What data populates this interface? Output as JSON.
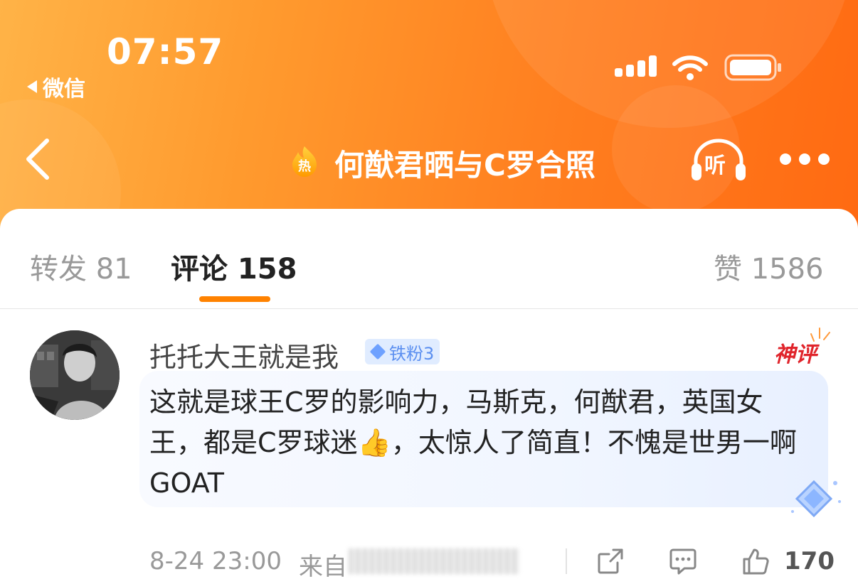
{
  "status_bar": {
    "time": "07:57",
    "back_app": "微信",
    "icons": [
      "signal-icon",
      "wifi-icon",
      "battery-icon"
    ]
  },
  "nav": {
    "title": "何猷君晒与C罗合照",
    "hot_badge": "热",
    "listen_label": "听",
    "icons": [
      "back-chevron-icon",
      "hot-badge-icon",
      "headphones-icon",
      "more-icon"
    ]
  },
  "tabs": {
    "repost": "转发 81",
    "comment": "评论 158",
    "likes": "赞 1586",
    "active": "comment"
  },
  "comment": {
    "username": "托托大王就是我",
    "fan_badge": "铁粉3",
    "god_label": "神评",
    "text": "这就是球王C罗的影响力，马斯克，何猷君，英国女王，都是C罗球迷👍，太惊人了简直！不愧是世男一啊GOAT",
    "time": "8-24 23:00",
    "source_prefix": "来自",
    "like_count": "170"
  },
  "colors": {
    "accent": "#ff8200",
    "header_start": "#ffb347",
    "header_end": "#ff6a12",
    "god_label": "#e0242b",
    "badge_text": "#5b8ff0"
  }
}
